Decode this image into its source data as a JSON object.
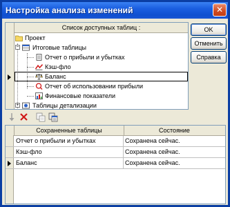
{
  "window": {
    "title": "Настройка анализа изменений",
    "close_glyph": "✕"
  },
  "tree": {
    "header": "Список доступных таблиц :",
    "items": [
      {
        "label": "Проект",
        "icon": "folder-icon"
      },
      {
        "label": "Итоговые таблицы",
        "icon": "table-icon"
      },
      {
        "label": "Отчет о прибыли и убытках",
        "icon": "report-icon"
      },
      {
        "label": "Кэш-фло",
        "icon": "cashflow-icon"
      },
      {
        "label": "Баланс",
        "icon": "balance-icon"
      },
      {
        "label": "Отчет об использовании прибыли",
        "icon": "profit-usage-icon"
      },
      {
        "label": "Финансовые показатели",
        "icon": "indicators-icon"
      },
      {
        "label": "Таблицы детализации",
        "icon": "detail-tables-icon"
      }
    ],
    "selected_index": 4
  },
  "buttons": {
    "ok": "OK",
    "cancel": "Отменить",
    "help": "Справка"
  },
  "toolbar": {
    "icons": [
      "move-down-icon",
      "delete-icon",
      "copy-table-icon",
      "paste-table-icon"
    ]
  },
  "grid": {
    "columns": [
      "Сохраненные таблицы",
      "Состояние"
    ],
    "rows": [
      {
        "table": "Отчет о прибыли и убытках",
        "status": "Сохранена сейчас."
      },
      {
        "table": "Кэш-фло",
        "status": "Сохранена сейчас."
      },
      {
        "table": "Баланс",
        "status": "Сохранена сейчас."
      }
    ],
    "current_row": 2
  },
  "colors": {
    "titlebar": "#1a5ee0",
    "dialog_bg": "#ece9d8",
    "accent_red": "#d01818"
  }
}
